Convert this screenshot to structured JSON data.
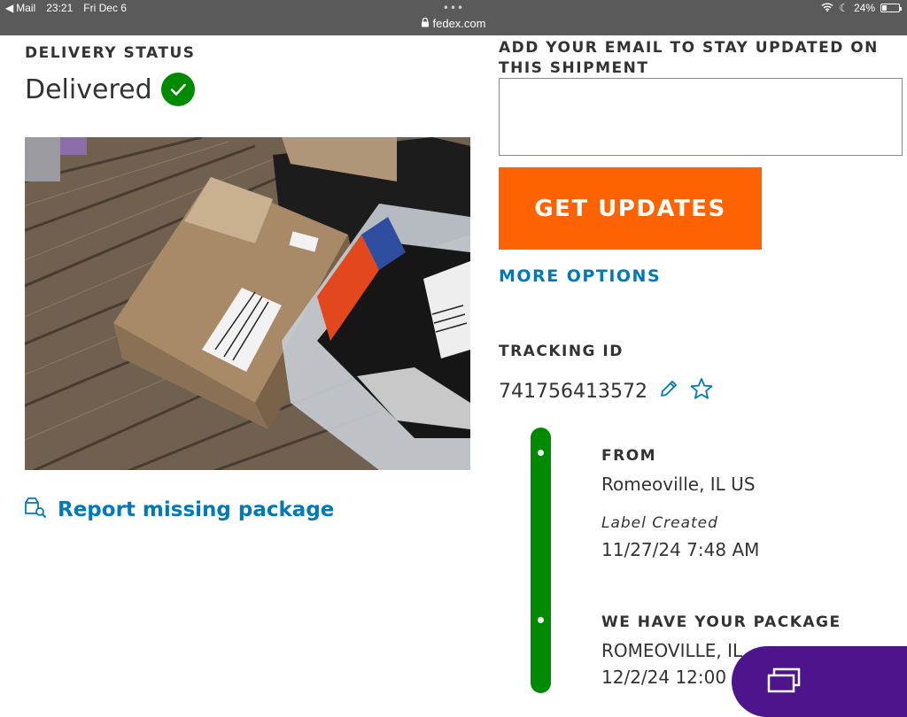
{
  "status_bar": {
    "back_app": "Mail",
    "time": "23:21",
    "date": "Fri Dec 6",
    "dots": "•••",
    "url": "fedex.com",
    "battery": "24%",
    "battery_level": 0.24
  },
  "delivery": {
    "status_label": "DELIVERY STATUS",
    "status_value": "Delivered",
    "report_link": "Report missing package"
  },
  "updates": {
    "email_heading": "ADD YOUR EMAIL TO STAY UPDATED ON THIS SHIPMENT",
    "email_value": "",
    "email_placeholder": "",
    "button_label": "GET UPDATES",
    "more_options": "MORE OPTIONS"
  },
  "tracking": {
    "label": "TRACKING ID",
    "id": "741756413572"
  },
  "timeline": {
    "from_heading": "FROM",
    "from_location": "Romeoville, IL US",
    "label_created": "Label Created",
    "label_date": "11/27/24 7:48 AM",
    "package_heading": "WE HAVE YOUR PACKAGE",
    "package_location": "ROMEOVILLE, IL",
    "package_date": "12/2/24 12:00"
  },
  "colors": {
    "accent_orange": "#ff6200",
    "link_blue": "#007ab7",
    "status_green": "#008a00",
    "fedex_purple": "#4d148c"
  }
}
